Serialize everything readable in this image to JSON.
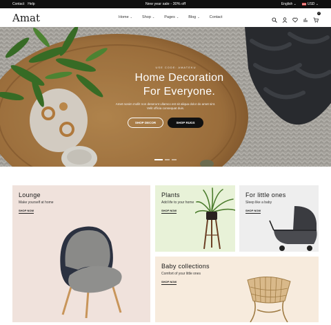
{
  "topbar": {
    "links": [
      "Contact",
      "Help"
    ],
    "promo": "New year sale - 30% off",
    "language": "English",
    "currency": "USD"
  },
  "header": {
    "logo": "Amat",
    "nav": [
      {
        "label": "Home",
        "dropdown": true
      },
      {
        "label": "Shop",
        "dropdown": true
      },
      {
        "label": "Pages",
        "dropdown": true
      },
      {
        "label": "Blog",
        "dropdown": true
      },
      {
        "label": "Contact",
        "dropdown": false
      }
    ],
    "icons": [
      "search-icon",
      "user-icon",
      "heart-icon",
      "compare-icon",
      "cart-icon"
    ],
    "cart_count": "0"
  },
  "hero": {
    "eyebrow": "USE CODE: AMATEKU",
    "title_line1": "Home Decoration",
    "title_line2": "For Everyone.",
    "text": "Amet nonim mollit non deserunt ullamco est sit aliqua dolor do amet sint. Velit officia consequat duis.",
    "button_outline": "SHOP DECOR",
    "button_dark": "SHOP RUGS",
    "slides": 3,
    "active_slide": 1
  },
  "categories": [
    {
      "key": "lounge",
      "title": "Lounge",
      "subtitle": "Make yourself at home",
      "cta": "SHOP NOW"
    },
    {
      "key": "plants",
      "title": "Plants",
      "subtitle": "Add life to your home",
      "cta": "SHOP NOW"
    },
    {
      "key": "little",
      "title": "For little ones",
      "subtitle": "Sleep like a baby",
      "cta": "SHOP NOW"
    },
    {
      "key": "baby",
      "title": "Baby collections",
      "subtitle": "Comfort of your little ones",
      "cta": "SHOP NOW"
    }
  ],
  "colors": {
    "topbar_bg": "#0f0f0f",
    "lounge_bg": "#f0e2dc",
    "plants_bg": "#e8f2d8",
    "little_bg": "#eeeeee",
    "baby_bg": "#f7ebdd",
    "accent_dark": "#111111"
  }
}
